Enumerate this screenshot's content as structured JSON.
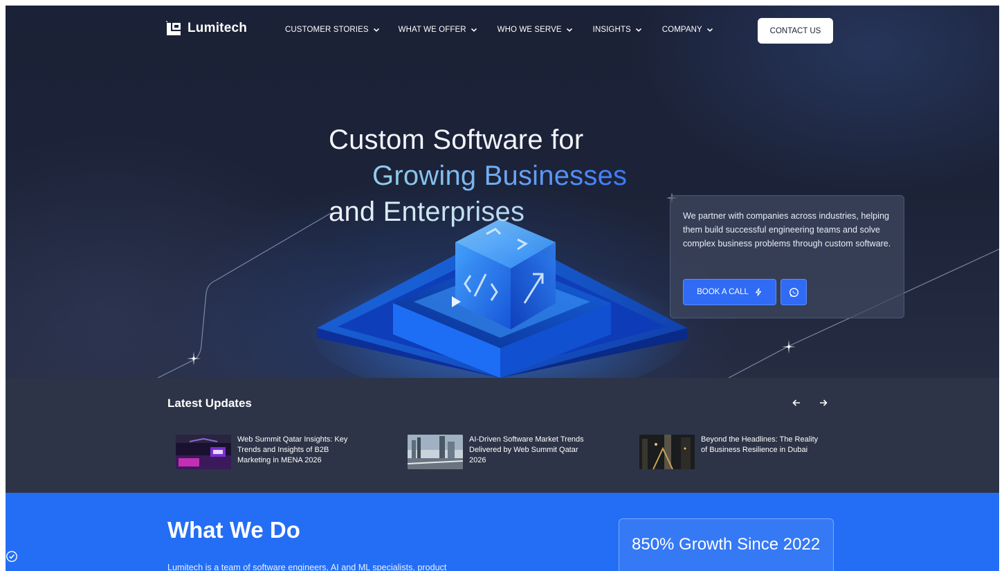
{
  "brand": {
    "name": "Lumitech"
  },
  "nav": {
    "items": [
      {
        "label": "CUSTOMER STORIES"
      },
      {
        "label": "WHAT WE OFFER"
      },
      {
        "label": "WHO WE SERVE"
      },
      {
        "label": "INSIGHTS"
      },
      {
        "label": "COMPANY"
      }
    ],
    "contact_label": "CONTACT US"
  },
  "hero": {
    "line1": "Custom Software for",
    "line2": "Growing Businesses",
    "line3": "and Enterprises",
    "card_text": "We partner with companies across industries, helping them build successful engineering teams and solve complex business problems through custom software.",
    "book_label": "BOOK A CALL"
  },
  "updates": {
    "title": "Latest Updates",
    "items": [
      {
        "title": "Web Summit Qatar Insights: Key Trends and Insights of B2B Marketing in MENA 2026"
      },
      {
        "title": "AI-Driven Software Market Trends Delivered by Web Summit Qatar 2026"
      },
      {
        "title": "Beyond the Headlines: The Reality of Business Resilience in Dubai"
      }
    ]
  },
  "what_we_do": {
    "title": "What We Do",
    "body": "Lumitech is a team of software engineers, AI and ML specialists, product",
    "growth": "850% Growth Since 2022"
  },
  "colors": {
    "hero_bg": "#1c2338",
    "updates_bg": "#2d3447",
    "accent_blue": "#246ef5",
    "button_blue": "#2f6bf5"
  },
  "icons": [
    "chevron-down-icon",
    "lightning-icon",
    "whatsapp-icon",
    "arrow-left-icon",
    "arrow-right-icon",
    "accessibility-check-icon"
  ]
}
